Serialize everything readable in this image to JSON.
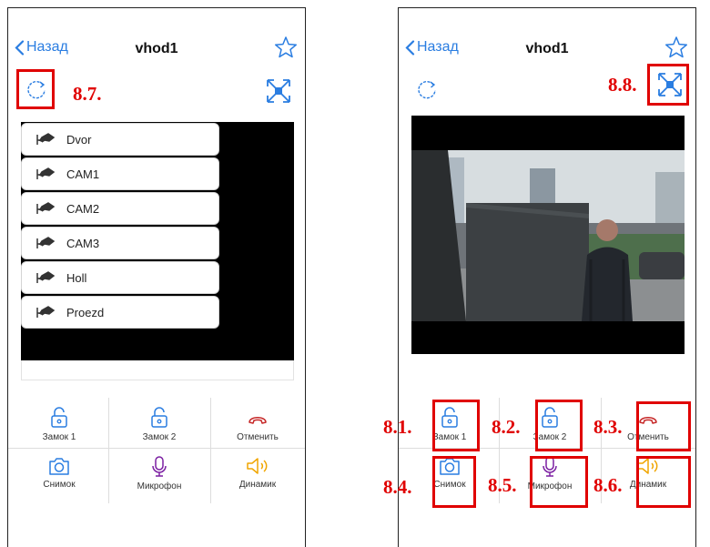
{
  "left_screen": {
    "back_label": "Назад",
    "title": "vhod1",
    "callout_refresh": "8.7.",
    "camera_list": [
      "Dvor",
      "CAM1",
      "CAM2",
      "CAM3",
      "Holl",
      "Proezd"
    ],
    "controls": {
      "lock1": "Замок 1",
      "lock2": "Замок 2",
      "cancel": "Отменить",
      "snapshot": "Снимок",
      "microphone": "Микрофон",
      "speaker": "Динамик"
    }
  },
  "right_screen": {
    "back_label": "Назад",
    "title": "vhod1",
    "callouts": {
      "fullscreen": "8.8.",
      "lock1": "8.1.",
      "lock2": "8.2.",
      "cancel": "8.3.",
      "snapshot": "8.4.",
      "microphone": "8.5.",
      "speaker": "8.6."
    },
    "controls": {
      "lock1": "Замок 1",
      "lock2": "Замок 2",
      "cancel": "Отменить",
      "snapshot": "Снимок",
      "microphone": "Микрофон",
      "speaker": "Динамик"
    }
  },
  "colors": {
    "accent": "#2a7de1",
    "lock_icon": "#2a7de1",
    "cancel_icon": "#c62828",
    "snapshot_icon": "#2a7de1",
    "microphone_icon": "#7b1fa2",
    "speaker_icon": "#f0a500",
    "callout": "#e00000",
    "video_bg": "#000000"
  },
  "icons": [
    "back-chevron-icon",
    "star-icon",
    "refresh-icon",
    "fullscreen-icon",
    "camera-icon",
    "lock-icon",
    "phone-hangup-icon",
    "photo-camera-icon",
    "microphone-icon",
    "speaker-icon"
  ]
}
